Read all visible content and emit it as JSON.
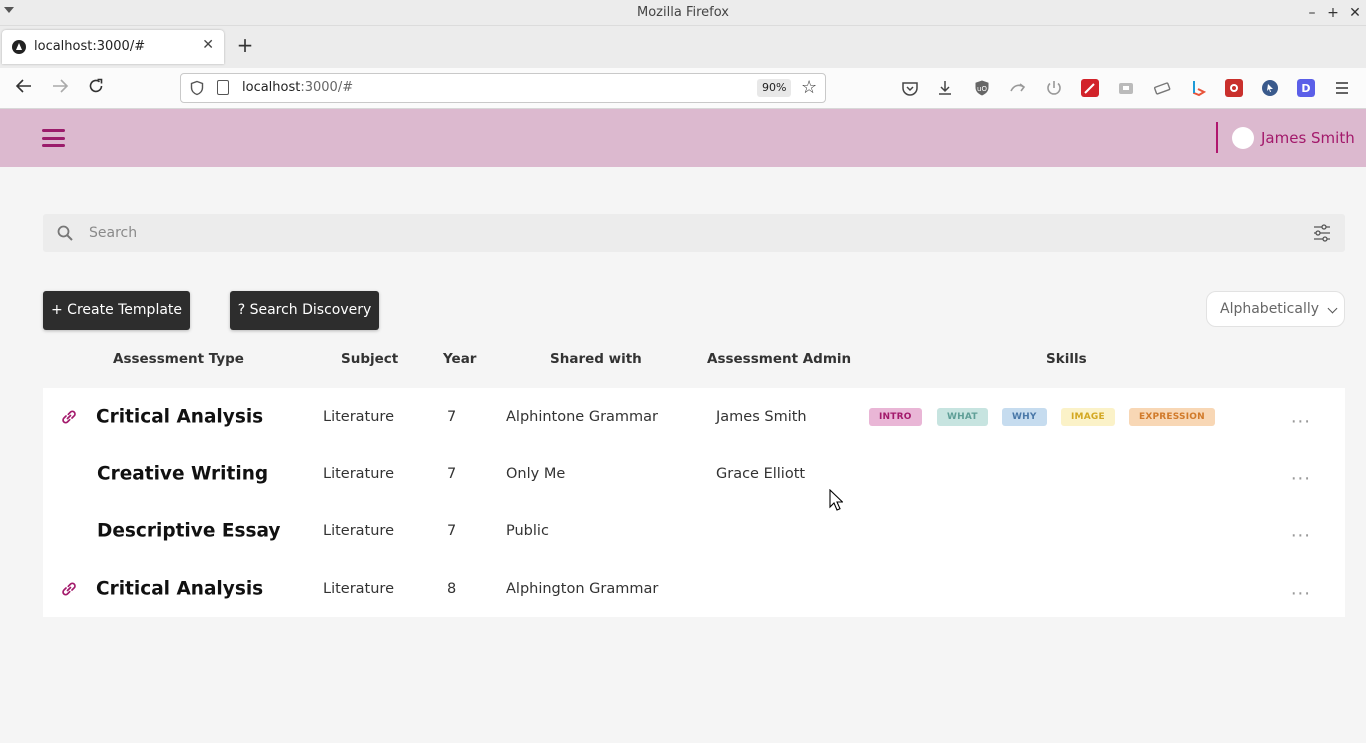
{
  "browser": {
    "window_title": "Mozilla Firefox",
    "tab_title": "localhost:3000/#",
    "url_host": "localhost",
    "url_rest": ":3000/#",
    "zoom": "90%"
  },
  "app": {
    "user_name": "James Smith",
    "search_placeholder": "Search",
    "create_button": "+ Create Template",
    "discovery_button": "? Search Discovery",
    "sort_value": "Alphabetically",
    "columns": {
      "assessment_type": "Assessment Type",
      "subject": "Subject",
      "year": "Year",
      "shared_with": "Shared with",
      "assessment_admin": "Assessment Admin",
      "skills": "Skills"
    },
    "rows": [
      {
        "type": "Critical Analysis",
        "subject": "Literature",
        "year": "7",
        "shared": "Alphintone Grammar",
        "admin": "James Smith",
        "linked": true,
        "skills": [
          {
            "label": "INTRO",
            "bg": "#e9b6d6",
            "fg": "#a3196b"
          },
          {
            "label": "WHAT",
            "bg": "#c7e4e0",
            "fg": "#5f9f97"
          },
          {
            "label": "WHY",
            "bg": "#c6dcef",
            "fg": "#4a78a8"
          },
          {
            "label": "IMAGE",
            "bg": "#fbf2c8",
            "fg": "#d3a822"
          },
          {
            "label": "EXPRESSION",
            "bg": "#f8d7b5",
            "fg": "#d17a2a"
          }
        ]
      },
      {
        "type": "Creative Writing",
        "subject": "Literature",
        "year": "7",
        "shared": "Only Me",
        "admin": "Grace Elliott",
        "linked": false,
        "skills": []
      },
      {
        "type": "Descriptive Essay",
        "subject": "Literature",
        "year": "7",
        "shared": "Public",
        "admin": "",
        "linked": false,
        "skills": []
      },
      {
        "type": "Critical Analysis",
        "subject": "Literature",
        "year": "8",
        "shared": "Alphington Grammar",
        "admin": "",
        "linked": true,
        "skills": []
      }
    ],
    "more_label": "..."
  },
  "colors": {
    "appbar": "#dcb9cf",
    "accent": "#a3196b",
    "dark_button": "#2d2d2d"
  }
}
